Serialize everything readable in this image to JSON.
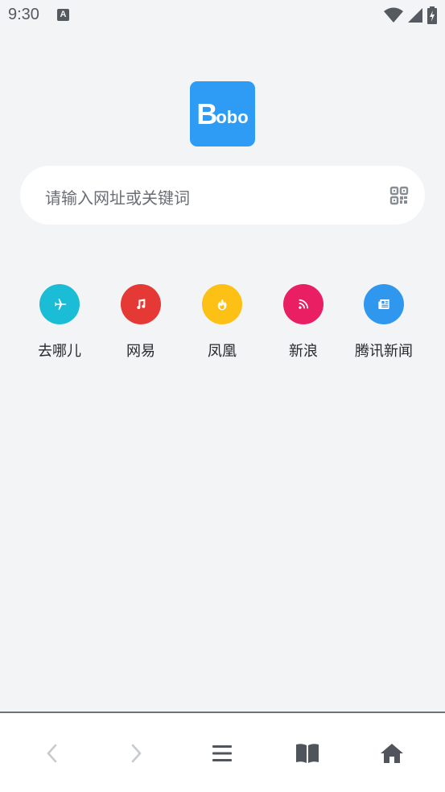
{
  "status_bar": {
    "time": "9:30",
    "notification_icon_letter": "A"
  },
  "logo": {
    "first_letter": "B",
    "rest": "obo",
    "color": "#2e9bf5"
  },
  "search": {
    "placeholder": "请输入网址或关键词",
    "qr_icon": "qr-code-icon"
  },
  "quick_links": [
    {
      "label": "去哪儿",
      "icon": "airplane-icon",
      "color": "#1bbcd6"
    },
    {
      "label": "网易",
      "icon": "music-note-icon",
      "color": "#e53935"
    },
    {
      "label": "凤凰",
      "icon": "flame-icon",
      "color": "#fdc014"
    },
    {
      "label": "新浪",
      "icon": "rss-icon",
      "color": "#e91e63"
    },
    {
      "label": "腾讯新闻",
      "icon": "newspaper-icon",
      "color": "#2f97ee"
    }
  ],
  "bottom_nav": [
    {
      "name": "back",
      "icon": "chevron-left-icon"
    },
    {
      "name": "forward",
      "icon": "chevron-right-icon"
    },
    {
      "name": "menu",
      "icon": "menu-icon"
    },
    {
      "name": "bookmarks",
      "icon": "book-icon"
    },
    {
      "name": "home",
      "icon": "home-icon"
    }
  ]
}
